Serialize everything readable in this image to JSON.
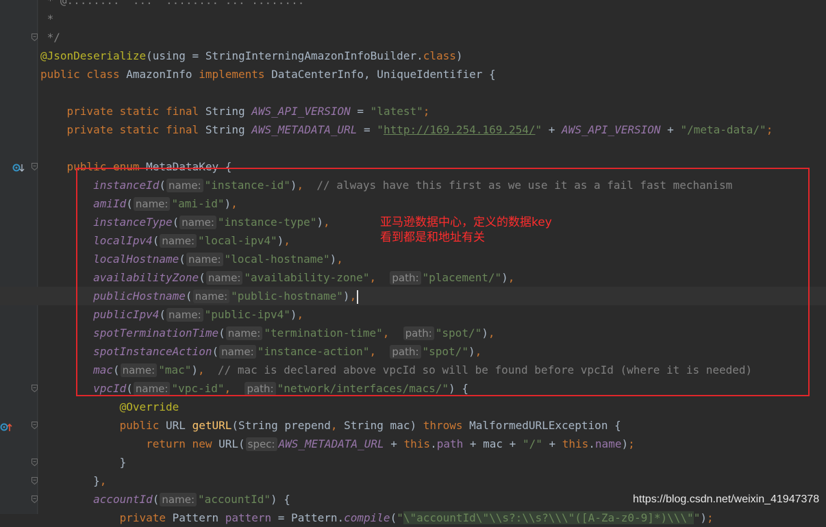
{
  "editor": {
    "language": "Java",
    "lines": [
      {
        "tokens": [
          {
            "t": " * ",
            "c": "cmt"
          },
          {
            "t": "@",
            "c": "cmt"
          },
          {
            "t": "........",
            "c": "cmt"
          },
          {
            "t": "  ...  ........ ... ........",
            "c": "cmt"
          }
        ],
        "fold": false
      },
      {
        "tokens": [
          {
            "t": " *",
            "c": "cmt"
          }
        ],
        "fold": false
      },
      {
        "tokens": [
          {
            "t": " */",
            "c": "cmt"
          }
        ],
        "fold": true
      },
      {
        "tokens": [
          {
            "t": "@JsonDeserialize",
            "c": "ann"
          },
          {
            "t": "(using = StringInterningAmazonInfoBuilder.",
            "c": ""
          },
          {
            "t": "class",
            "c": "kw"
          },
          {
            "t": ")",
            "c": ""
          }
        ],
        "fold": false
      },
      {
        "tokens": [
          {
            "t": "public class ",
            "c": "kw"
          },
          {
            "t": "AmazonInfo ",
            "c": ""
          },
          {
            "t": "implements ",
            "c": "kw"
          },
          {
            "t": "DataCenterInfo, UniqueIdentifier {",
            "c": ""
          }
        ],
        "fold": false
      },
      {
        "tokens": [],
        "fold": false
      },
      {
        "tokens": [
          {
            "t": "    private static final ",
            "c": "kw"
          },
          {
            "t": "String ",
            "c": ""
          },
          {
            "t": "AWS_API_VERSION",
            "c": "stat"
          },
          {
            "t": " = ",
            "c": ""
          },
          {
            "t": "\"latest\"",
            "c": "str"
          },
          {
            "t": ";",
            "c": "kw"
          }
        ],
        "fold": false
      },
      {
        "tokens": [
          {
            "t": "    private static final ",
            "c": "kw"
          },
          {
            "t": "String ",
            "c": ""
          },
          {
            "t": "AWS_METADATA_URL",
            "c": "stat"
          },
          {
            "t": " = ",
            "c": ""
          },
          {
            "t": "\"",
            "c": "str"
          },
          {
            "t": "http://169.254.169.254/",
            "c": "url"
          },
          {
            "t": "\"",
            "c": "str"
          },
          {
            "t": " + ",
            "c": ""
          },
          {
            "t": "AWS_API_VERSION",
            "c": "stat"
          },
          {
            "t": " + ",
            "c": ""
          },
          {
            "t": "\"/meta-data/\"",
            "c": "str"
          },
          {
            "t": ";",
            "c": "kw"
          }
        ],
        "fold": false
      },
      {
        "tokens": [],
        "fold": false
      },
      {
        "tokens": [
          {
            "t": "    public enum ",
            "c": "kw"
          },
          {
            "t": "MetaDataKey {",
            "c": ""
          }
        ],
        "fold": true,
        "gutter_icon": "implemented-down-icon"
      },
      {
        "tokens": [
          {
            "t": "        ",
            "c": ""
          },
          {
            "t": "instanceId",
            "c": "enum"
          },
          {
            "t": "(",
            "c": ""
          },
          {
            "h": "name:"
          },
          {
            "t": "\"instance-id\"",
            "c": "str"
          },
          {
            "t": ")",
            "c": ""
          },
          {
            "t": ",  ",
            "c": "kw"
          },
          {
            "t": "// always have this first as we use it as a fail fast mechanism",
            "c": "cmt"
          }
        ],
        "fold": false
      },
      {
        "tokens": [
          {
            "t": "        ",
            "c": ""
          },
          {
            "t": "amiId",
            "c": "enum"
          },
          {
            "t": "(",
            "c": ""
          },
          {
            "h": "name:"
          },
          {
            "t": "\"ami-id\"",
            "c": "str"
          },
          {
            "t": ")",
            "c": ""
          },
          {
            "t": ",",
            "c": "kw"
          }
        ],
        "fold": false
      },
      {
        "tokens": [
          {
            "t": "        ",
            "c": ""
          },
          {
            "t": "instanceType",
            "c": "enum"
          },
          {
            "t": "(",
            "c": ""
          },
          {
            "h": "name:"
          },
          {
            "t": "\"instance-type\"",
            "c": "str"
          },
          {
            "t": ")",
            "c": ""
          },
          {
            "t": ",",
            "c": "kw"
          }
        ],
        "fold": false
      },
      {
        "tokens": [
          {
            "t": "        ",
            "c": ""
          },
          {
            "t": "localIpv4",
            "c": "enum"
          },
          {
            "t": "(",
            "c": ""
          },
          {
            "h": "name:"
          },
          {
            "t": "\"local-ipv4\"",
            "c": "str"
          },
          {
            "t": ")",
            "c": ""
          },
          {
            "t": ",",
            "c": "kw"
          }
        ],
        "fold": false
      },
      {
        "tokens": [
          {
            "t": "        ",
            "c": ""
          },
          {
            "t": "localHostname",
            "c": "enum"
          },
          {
            "t": "(",
            "c": ""
          },
          {
            "h": "name:"
          },
          {
            "t": "\"local-hostname\"",
            "c": "str"
          },
          {
            "t": ")",
            "c": ""
          },
          {
            "t": ",",
            "c": "kw"
          }
        ],
        "fold": false
      },
      {
        "tokens": [
          {
            "t": "        ",
            "c": ""
          },
          {
            "t": "availabilityZone",
            "c": "enum"
          },
          {
            "t": "(",
            "c": ""
          },
          {
            "h": "name:"
          },
          {
            "t": "\"availability-zone\"",
            "c": "str"
          },
          {
            "t": ",  ",
            "c": "kw"
          },
          {
            "h": "path:"
          },
          {
            "t": "\"placement/\"",
            "c": "str"
          },
          {
            "t": ")",
            "c": ""
          },
          {
            "t": ",",
            "c": "kw"
          }
        ],
        "fold": false
      },
      {
        "tokens": [
          {
            "t": "        ",
            "c": ""
          },
          {
            "t": "publicHostname",
            "c": "enum"
          },
          {
            "t": "(",
            "c": ""
          },
          {
            "h": "name:"
          },
          {
            "t": "\"public-hostname\"",
            "c": "str"
          },
          {
            "t": ")",
            "c": ""
          },
          {
            "t": ",",
            "c": "kw"
          },
          {
            "caret": true
          }
        ],
        "fold": false,
        "current": true
      },
      {
        "tokens": [
          {
            "t": "        ",
            "c": ""
          },
          {
            "t": "publicIpv4",
            "c": "enum"
          },
          {
            "t": "(",
            "c": ""
          },
          {
            "h": "name:"
          },
          {
            "t": "\"public-ipv4\"",
            "c": "str"
          },
          {
            "t": ")",
            "c": ""
          },
          {
            "t": ",",
            "c": "kw"
          }
        ],
        "fold": false
      },
      {
        "tokens": [
          {
            "t": "        ",
            "c": ""
          },
          {
            "t": "spotTerminationTime",
            "c": "enum"
          },
          {
            "t": "(",
            "c": ""
          },
          {
            "h": "name:"
          },
          {
            "t": "\"termination-time\"",
            "c": "str"
          },
          {
            "t": ",  ",
            "c": "kw"
          },
          {
            "h": "path:"
          },
          {
            "t": "\"spot/\"",
            "c": "str"
          },
          {
            "t": ")",
            "c": ""
          },
          {
            "t": ",",
            "c": "kw"
          }
        ],
        "fold": false
      },
      {
        "tokens": [
          {
            "t": "        ",
            "c": ""
          },
          {
            "t": "spotInstanceAction",
            "c": "enum"
          },
          {
            "t": "(",
            "c": ""
          },
          {
            "h": "name:"
          },
          {
            "t": "\"instance-action\"",
            "c": "str"
          },
          {
            "t": ",  ",
            "c": "kw"
          },
          {
            "h": "path:"
          },
          {
            "t": "\"spot/\"",
            "c": "str"
          },
          {
            "t": ")",
            "c": ""
          },
          {
            "t": ",",
            "c": "kw"
          }
        ],
        "fold": false
      },
      {
        "tokens": [
          {
            "t": "        ",
            "c": ""
          },
          {
            "t": "mac",
            "c": "enum"
          },
          {
            "t": "(",
            "c": ""
          },
          {
            "h": "name:"
          },
          {
            "t": "\"mac\"",
            "c": "str"
          },
          {
            "t": ")",
            "c": ""
          },
          {
            "t": ",  ",
            "c": "kw"
          },
          {
            "t": "// mac is declared above vpcId so will be found before vpcId (where it is needed)",
            "c": "cmt"
          }
        ],
        "fold": false
      },
      {
        "tokens": [
          {
            "t": "        ",
            "c": ""
          },
          {
            "t": "vpcId",
            "c": "enum"
          },
          {
            "t": "(",
            "c": ""
          },
          {
            "h": "name:"
          },
          {
            "t": "\"vpc-id\"",
            "c": "str"
          },
          {
            "t": ",  ",
            "c": "kw"
          },
          {
            "h": "path:"
          },
          {
            "t": "\"network/interfaces/macs/\"",
            "c": "str"
          },
          {
            "t": ") {",
            "c": ""
          }
        ],
        "fold": true
      },
      {
        "tokens": [
          {
            "t": "            ",
            "c": ""
          },
          {
            "t": "@Override",
            "c": "ann"
          }
        ],
        "fold": false
      },
      {
        "tokens": [
          {
            "t": "            ",
            "c": ""
          },
          {
            "t": "public ",
            "c": "kw"
          },
          {
            "t": "URL ",
            "c": ""
          },
          {
            "t": "getURL",
            "c": "fn"
          },
          {
            "t": "(String prepend",
            "c": ""
          },
          {
            "t": ", ",
            "c": "kw"
          },
          {
            "t": "String mac) ",
            "c": ""
          },
          {
            "t": "throws ",
            "c": "kw"
          },
          {
            "t": "MalformedURLException {",
            "c": ""
          }
        ],
        "fold": true,
        "gutter_icon": "override-up-icon"
      },
      {
        "tokens": [
          {
            "t": "                ",
            "c": ""
          },
          {
            "t": "return new ",
            "c": "kw"
          },
          {
            "t": "URL(",
            "c": ""
          },
          {
            "h": "spec:"
          },
          {
            "t": "AWS_METADATA_URL",
            "c": "stat"
          },
          {
            "t": " + ",
            "c": ""
          },
          {
            "t": "this",
            "c": "kw"
          },
          {
            "t": ".",
            "c": ""
          },
          {
            "t": "path",
            "c": "fld"
          },
          {
            "t": " + mac + ",
            "c": ""
          },
          {
            "t": "\"/\"",
            "c": "str"
          },
          {
            "t": " + ",
            "c": ""
          },
          {
            "t": "this",
            "c": "kw"
          },
          {
            "t": ".",
            "c": ""
          },
          {
            "t": "name",
            "c": "fld"
          },
          {
            "t": ")",
            "c": ""
          },
          {
            "t": ";",
            "c": "kw"
          }
        ],
        "fold": false
      },
      {
        "tokens": [
          {
            "t": "            }",
            "c": ""
          }
        ],
        "fold": true
      },
      {
        "tokens": [
          {
            "t": "        }",
            "c": ""
          },
          {
            "t": ",",
            "c": "kw"
          }
        ],
        "fold": true
      },
      {
        "tokens": [
          {
            "t": "        ",
            "c": ""
          },
          {
            "t": "accountId",
            "c": "enum"
          },
          {
            "t": "(",
            "c": ""
          },
          {
            "h": "name:"
          },
          {
            "t": "\"accountId\"",
            "c": "str"
          },
          {
            "t": ") {",
            "c": ""
          }
        ],
        "fold": true
      },
      {
        "tokens": [
          {
            "t": "            ",
            "c": ""
          },
          {
            "t": "private ",
            "c": "kw"
          },
          {
            "t": "Pattern ",
            "c": ""
          },
          {
            "t": "pattern",
            "c": "fld"
          },
          {
            "t": " = Pattern.",
            "c": ""
          },
          {
            "t": "compile",
            "c": "enum"
          },
          {
            "t": "(",
            "c": ""
          },
          {
            "t": "\"",
            "c": "str"
          },
          {
            "t": "\\\"accountId\\\"\\\\s?:\\\\s?\\\\\\\"([A-Za-z0-9]*)\\\\\\\"",
            "c": "regex"
          },
          {
            "t": "\"",
            "c": "str"
          },
          {
            "t": ")",
            "c": ""
          },
          {
            "t": ";",
            "c": "kw"
          }
        ],
        "fold": false
      }
    ]
  },
  "annotation": {
    "line1": "亚马逊数据中心，定义的数据key",
    "line2": "看到都是和地址有关",
    "border_color": "#e0262a",
    "text_color": "#ff2d2d"
  },
  "watermark": "https://blog.csdn.net/weixin_41947378"
}
